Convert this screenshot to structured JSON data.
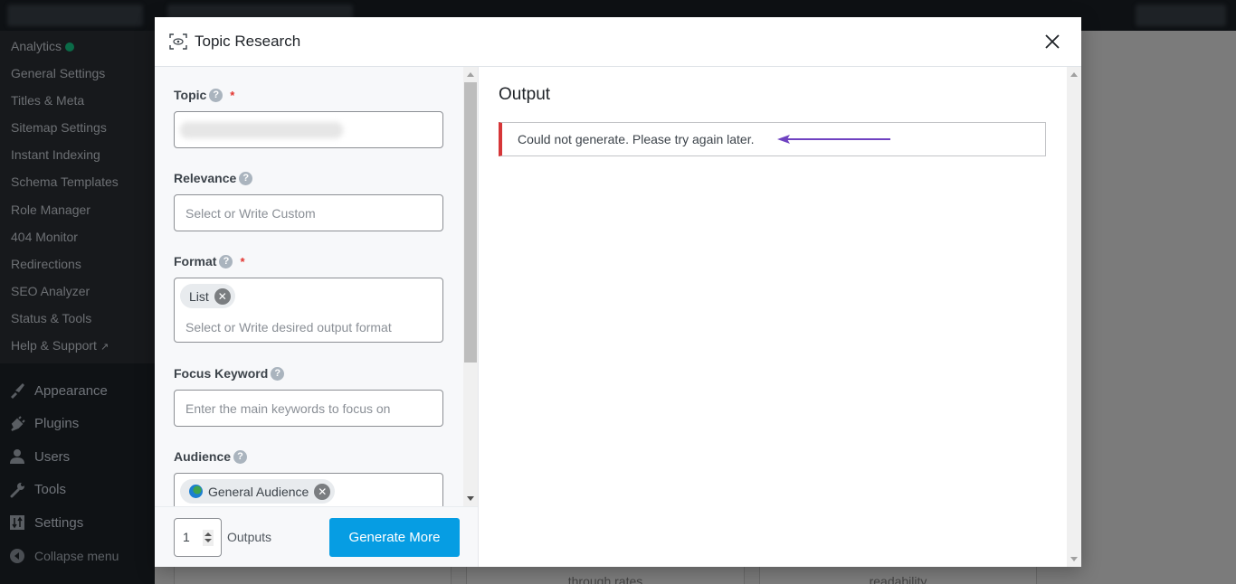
{
  "sidebar": {
    "submenu": [
      {
        "label": "Analytics",
        "status_dot": true
      },
      {
        "label": "General Settings"
      },
      {
        "label": "Titles & Meta"
      },
      {
        "label": "Sitemap Settings"
      },
      {
        "label": "Instant Indexing"
      },
      {
        "label": "Schema Templates"
      },
      {
        "label": "Role Manager"
      },
      {
        "label": "404 Monitor"
      },
      {
        "label": "Redirections"
      },
      {
        "label": "SEO Analyzer"
      },
      {
        "label": "Status & Tools"
      },
      {
        "label": "Help & Support",
        "external": true
      }
    ],
    "menu": [
      {
        "label": "Appearance",
        "icon": "paintbrush-icon"
      },
      {
        "label": "Plugins",
        "icon": "plugin-icon"
      },
      {
        "label": "Users",
        "icon": "user-icon"
      },
      {
        "label": "Tools",
        "icon": "wrench-icon"
      },
      {
        "label": "Settings",
        "icon": "settings-icon"
      },
      {
        "label": "Collapse menu",
        "icon": "collapse-icon"
      }
    ],
    "status_dot_color": "#0b6b48"
  },
  "background": {
    "cards": [
      "",
      "through rates",
      "readability"
    ]
  },
  "modal": {
    "title": "Topic Research",
    "close_label": "×",
    "fields": {
      "topic": {
        "label": "Topic",
        "required": "*",
        "help": "?"
      },
      "relevance": {
        "label": "Relevance",
        "help": "?",
        "placeholder": "Select or Write Custom"
      },
      "format": {
        "label": "Format",
        "required": "*",
        "help": "?",
        "chips": [
          "List"
        ],
        "placeholder": "Select or Write desired output format"
      },
      "focus_keyword": {
        "label": "Focus Keyword",
        "help": "?",
        "placeholder": "Enter the main keywords to focus on"
      },
      "audience": {
        "label": "Audience",
        "help": "?",
        "chips": [
          "General Audience"
        ]
      }
    },
    "footer": {
      "outputs_value": "1",
      "outputs_label": "Outputs",
      "generate_label": "Generate More"
    },
    "output": {
      "title": "Output",
      "error_message": "Could not generate. Please try again later."
    },
    "colors": {
      "accent": "#069de3",
      "error": "#d63638",
      "required": "#e3342f",
      "annotation_arrow": "#6f42c1"
    }
  }
}
